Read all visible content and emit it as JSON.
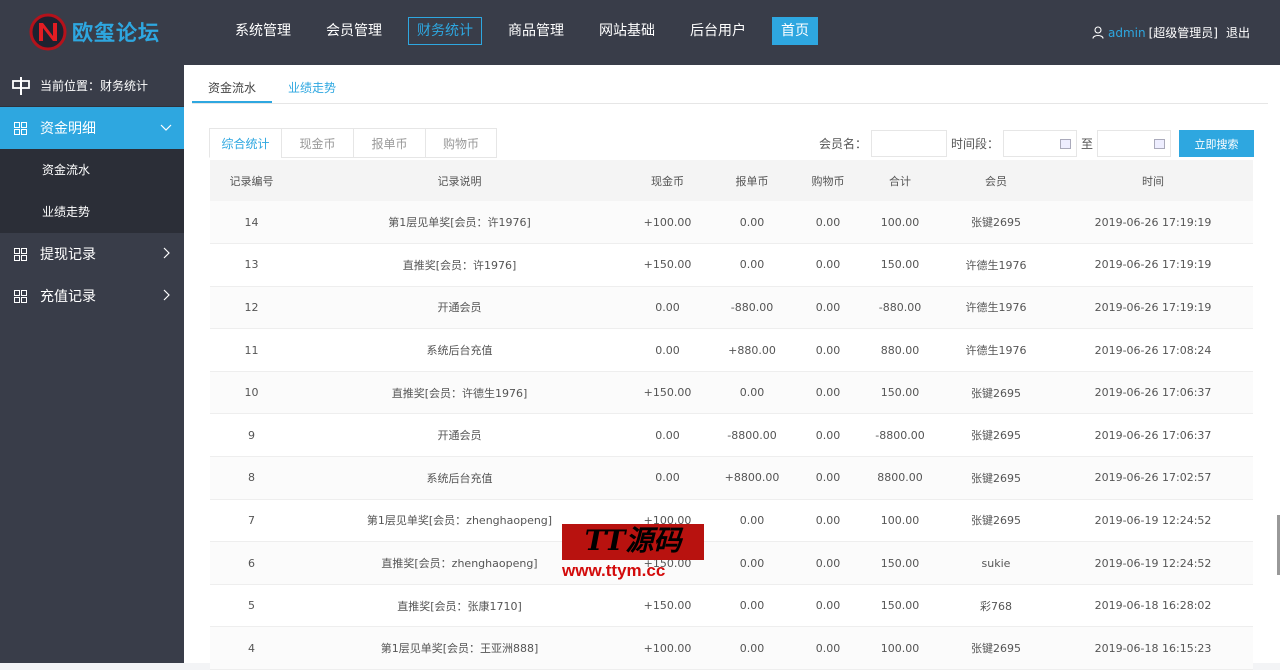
{
  "brand": {
    "name": "欧玺论坛"
  },
  "nav": {
    "items": [
      "系统管理",
      "会员管理",
      "财务统计",
      "商品管理",
      "网站基础",
      "后台用户",
      "首页"
    ]
  },
  "user": {
    "name": "admin",
    "role": "[超级管理员]",
    "logout": "退出"
  },
  "sidebar": {
    "crumb": "当前位置：财务统计",
    "groups": [
      {
        "label": "资金明细",
        "items": [
          "资金流水",
          "业绩走势"
        ]
      },
      {
        "label": "提现记录"
      },
      {
        "label": "充值记录"
      }
    ]
  },
  "tabs": [
    "资金流水",
    "业绩走势"
  ],
  "subtabs": [
    "综合统计",
    "现金币",
    "报单币",
    "购物币"
  ],
  "search": {
    "member_label": "会员名：",
    "period_label": "时间段：",
    "to_label": "至",
    "button": "立即搜索"
  },
  "table": {
    "headers": [
      "记录编号",
      "记录说明",
      "现金币",
      "报单币",
      "购物币",
      "合计",
      "会员",
      "时间"
    ],
    "rows": [
      [
        "14",
        "第1层见单奖[会员：许1976]",
        "+100.00",
        "0.00",
        "0.00",
        "100.00",
        "张键2695",
        "2019-06-26 17:19:19"
      ],
      [
        "13",
        "直推奖[会员：许1976]",
        "+150.00",
        "0.00",
        "0.00",
        "150.00",
        "许德生1976",
        "2019-06-26 17:19:19"
      ],
      [
        "12",
        "开通会员",
        "0.00",
        "-880.00",
        "0.00",
        "-880.00",
        "许德生1976",
        "2019-06-26 17:19:19"
      ],
      [
        "11",
        "系统后台充值",
        "0.00",
        "+880.00",
        "0.00",
        "880.00",
        "许德生1976",
        "2019-06-26 17:08:24"
      ],
      [
        "10",
        "直推奖[会员：许德生1976]",
        "+150.00",
        "0.00",
        "0.00",
        "150.00",
        "张键2695",
        "2019-06-26 17:06:37"
      ],
      [
        "9",
        "开通会员",
        "0.00",
        "-8800.00",
        "0.00",
        "-8800.00",
        "张键2695",
        "2019-06-26 17:06:37"
      ],
      [
        "8",
        "系统后台充值",
        "0.00",
        "+8800.00",
        "0.00",
        "8800.00",
        "张键2695",
        "2019-06-26 17:02:57"
      ],
      [
        "7",
        "第1层见单奖[会员：zhenghaopeng]",
        "+100.00",
        "0.00",
        "0.00",
        "100.00",
        "张键2695",
        "2019-06-19 12:24:52"
      ],
      [
        "6",
        "直推奖[会员：zhenghaopeng]",
        "+150.00",
        "0.00",
        "0.00",
        "150.00",
        "sukie",
        "2019-06-19 12:24:52"
      ],
      [
        "5",
        "直推奖[会员：张康1710]",
        "+150.00",
        "0.00",
        "0.00",
        "150.00",
        "彩768",
        "2019-06-18 16:28:02"
      ],
      [
        "4",
        "第1层见单奖[会员：王亚洲888]",
        "+100.00",
        "0.00",
        "0.00",
        "100.00",
        "张键2695",
        "2019-06-18 16:15:23"
      ]
    ]
  },
  "watermark": {
    "title": "TT源码",
    "url": "www.ttym.cc"
  },
  "colors": {
    "accent": "#2ea7e0",
    "dark": "#393d49"
  }
}
